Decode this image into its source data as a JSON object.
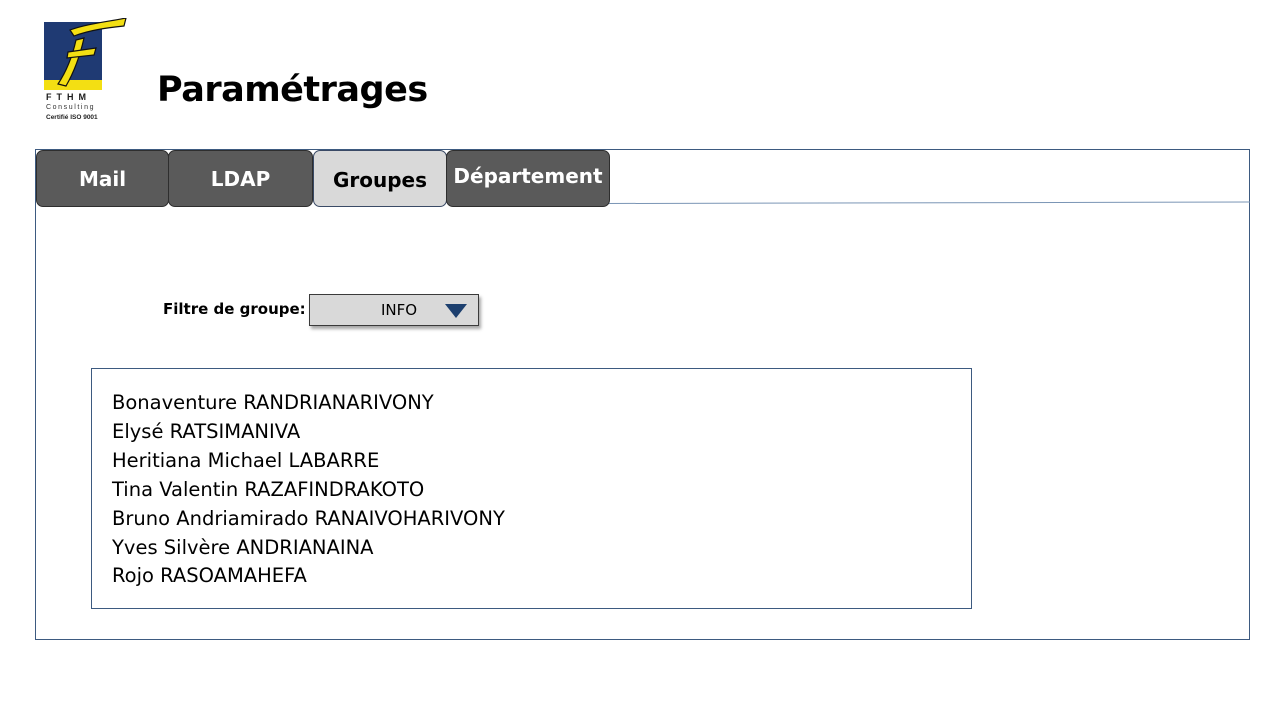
{
  "logo": {
    "letter": "F",
    "brand": "FTHM",
    "subtitle": "Consulting",
    "certification": "Certifié ISO 9001",
    "colors": {
      "box": "#1f3a73",
      "accent": "#f3df13"
    }
  },
  "page": {
    "title": "Paramétrages"
  },
  "tabs": [
    {
      "label": "Mail",
      "active": false
    },
    {
      "label": "LDAP",
      "active": false
    },
    {
      "label": "Groupes",
      "active": true
    },
    {
      "label": "Département",
      "active": false
    }
  ],
  "filter": {
    "label": "Filtre de groupe:",
    "selected": "INFO",
    "icon": "caret-down-icon"
  },
  "members": [
    "Bonaventure RANDRIANARIVONY",
    "Elysé RATSIMANIVA",
    "Heritiana Michael LABARRE",
    "Tina Valentin RAZAFINDRAKOTO",
    "Bruno Andriamirado RANAIVOHARIVONY",
    "Yves Silvère ANDRIANAINA",
    "Rojo RASOAMAHEFA"
  ],
  "colors": {
    "tab_inactive": "#5a5a5a",
    "tab_active": "#d9d9d9",
    "border": "#3d5a80",
    "arrow": "#1c3f6e"
  }
}
